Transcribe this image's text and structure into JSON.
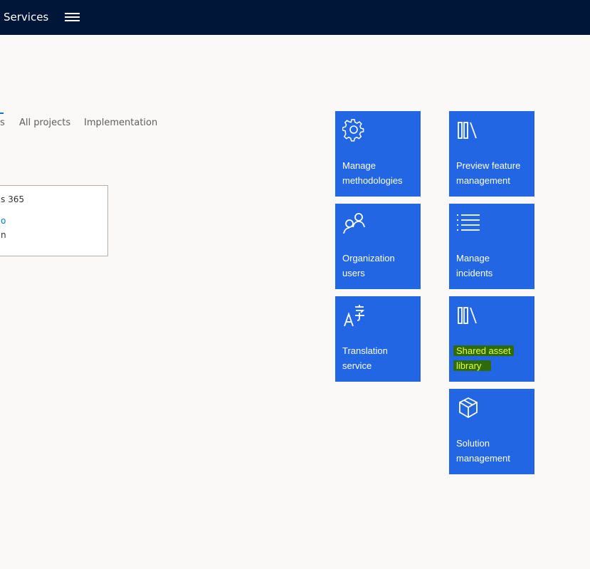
{
  "header": {
    "app_title": "Services"
  },
  "tabs": [
    {
      "label": "s"
    },
    {
      "label": "All projects"
    },
    {
      "label": "Implementation"
    }
  ],
  "card": {
    "line1": "s 365",
    "line2": "o",
    "line3": "n"
  },
  "tiles": [
    {
      "label_line1": "Manage",
      "label_line2": "methodologies",
      "icon": "gear-icon"
    },
    {
      "label_line1": "Preview feature",
      "label_line2": "management",
      "icon": "library-icon"
    },
    {
      "label_line1": "Organization",
      "label_line2": "users",
      "icon": "users-icon"
    },
    {
      "label_line1": "Manage",
      "label_line2": "incidents",
      "icon": "list-icon"
    },
    {
      "label_line1": "Translation",
      "label_line2": "service",
      "icon": "translate-icon"
    },
    {
      "label_line1": "Shared asset",
      "label_line2": "library",
      "icon": "library-icon",
      "highlighted": true
    },
    {
      "label_line1": "Solution",
      "label_line2": "management",
      "icon": "package-icon"
    }
  ],
  "colors": {
    "topbar": "#001638",
    "tile": "#2266e3",
    "highlight_bg": "#2e6b0a",
    "highlight_text": "#e8ff3a"
  }
}
